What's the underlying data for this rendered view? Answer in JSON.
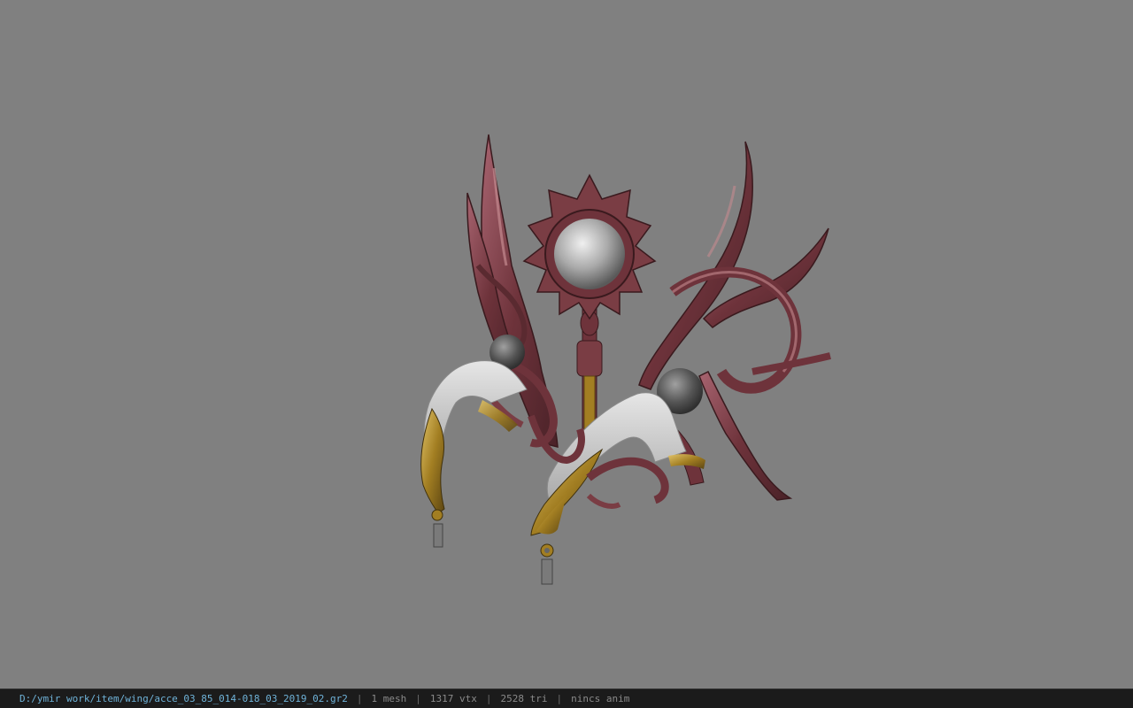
{
  "status_bar": {
    "file_path": "D:/ymir work/item/wing/acce_03_85_014-018_03_2019_02.gr2",
    "separator": "|",
    "mesh_count": "1 mesh",
    "vertex_count": "1317 vtx",
    "triangle_count": "2528 tri",
    "animation": "nincs anim"
  },
  "colors": {
    "background": "#808080",
    "status_bar_bg": "#1b1b1b",
    "path_text": "#6fb3d9",
    "stat_text": "#8a8a8a",
    "wing_red": "#7a3d44",
    "wing_highlight": "#c48a90",
    "cloth_white": "#d8d8d8",
    "gold": "#b08a2a",
    "orb_gray": "#6a6a6a"
  }
}
